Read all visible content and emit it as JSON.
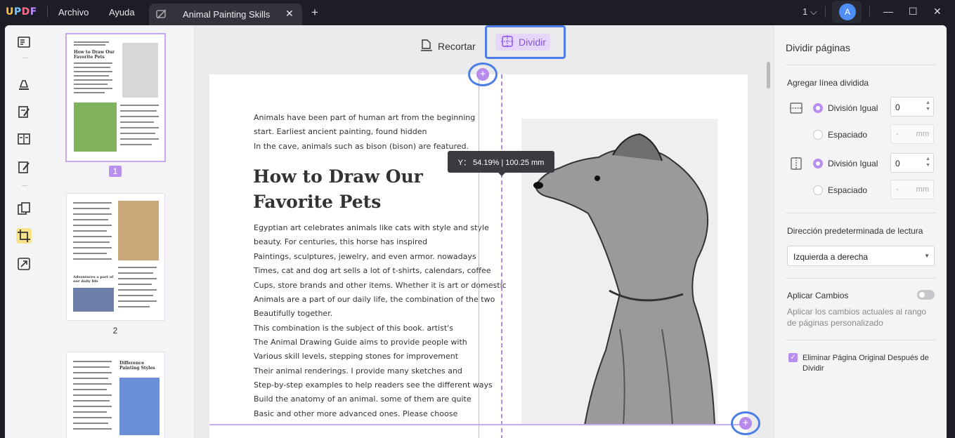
{
  "titlebar": {
    "logo": "UPDF",
    "menu": [
      "Archivo",
      "Ayuda"
    ],
    "tab_title": "Animal Painting Skills",
    "page_indicator": "1",
    "avatar_letter": "A"
  },
  "thumbnails": {
    "items": [
      {
        "label": "1",
        "heading": "How to Draw Our Favorite Pets",
        "selected": true
      },
      {
        "label": "2",
        "heading": "Adventures a part of our daily life",
        "selected": false
      },
      {
        "label": "",
        "heading": "Difference Painting Styles",
        "selected": false
      }
    ]
  },
  "toolbar": {
    "crop_label": "Recortar",
    "split_label": "Dividir"
  },
  "document": {
    "intro_lines": [
      "Animals have been part of human art from the beginning",
      "start. Earliest ancient painting, found hidden",
      "In the cave, animals such as bison (bison) are featured."
    ],
    "heading_line1": "How to Draw Our",
    "heading_line2": "Favorite Pets",
    "body_lines": [
      "Egyptian art celebrates animals like cats with style and style",
      "beauty. For centuries, this horse has inspired",
      "Paintings, sculptures, jewelry, and even armor. nowadays",
      "Times, cat and dog art sells a lot of t-shirts, calendars, coffee",
      "Cups, store brands and other items. Whether it is art or domestic",
      "Animals are a part of our daily life, the combination of the two",
      "Beautifully together.",
      "This combination is the subject of this book. artist's",
      "The Animal Drawing Guide aims to provide people with",
      "Various skill levels, stepping stones for improvement",
      "Their animal renderings. I provide many sketches and",
      "Step-by-step examples to help readers see the different ways",
      "Build the anatomy of an animal. some of them are quite",
      "Basic and other more advanced ones. Please choose"
    ],
    "tooltip": "Y： 54.19% | 100.25 mm"
  },
  "panel": {
    "title": "Dividir páginas",
    "add_line_label": "Agregar línea dividida",
    "horizontal": {
      "equal_label": "División Igual",
      "equal_value": "0",
      "spaced_label": "Espaciado",
      "spaced_placeholder": "-",
      "unit": "mm"
    },
    "vertical": {
      "equal_label": "División Igual",
      "equal_value": "0",
      "spaced_label": "Espaciado",
      "spaced_placeholder": "-",
      "unit": "mm"
    },
    "direction_label": "Dirección predeterminada de lectura",
    "direction_value": "Izquierda a derecha",
    "apply_label": "Aplicar Cambios",
    "apply_on": false,
    "apply_desc": "Aplicar los cambios actuales al rango de páginas personalizado",
    "delete_original_label": "Eliminar Página Original Después de Dividir",
    "delete_original_checked": true
  },
  "colors": {
    "accent": "#b88df0",
    "highlight": "#4b7ee6",
    "titlebar": "#1d1d26"
  }
}
